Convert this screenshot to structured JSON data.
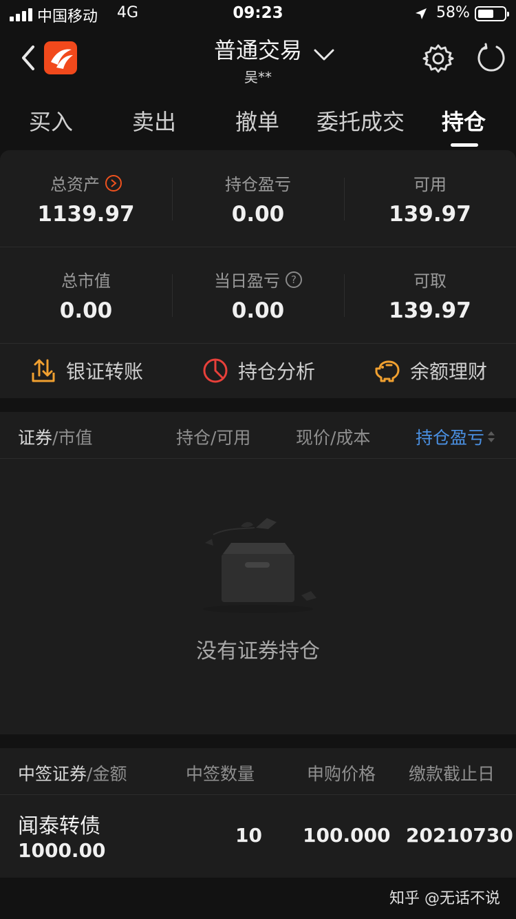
{
  "status_bar": {
    "carrier": "中国移动",
    "network": "4G",
    "time": "09:23",
    "battery": "58%",
    "battery_level": 0.58
  },
  "header": {
    "title": "普通交易",
    "account": "吴**"
  },
  "tabs": [
    "买入",
    "卖出",
    "撤单",
    "委托成交",
    "持仓"
  ],
  "active_tab": "持仓",
  "summary": {
    "total_assets_label": "总资产",
    "total_assets_value": "1139.97",
    "position_pl_label": "持仓盈亏",
    "position_pl_value": "0.00",
    "available_label": "可用",
    "available_value": "139.97",
    "market_value_label": "总市值",
    "market_value_value": "0.00",
    "daily_pl_label": "当日盈亏",
    "daily_pl_value": "0.00",
    "withdrawable_label": "可取",
    "withdrawable_value": "139.97",
    "help_glyph": "?"
  },
  "actions": {
    "bank_transfer": "银证转账",
    "position_analysis": "持仓分析",
    "balance_finance": "余额理财"
  },
  "positions_table": {
    "col1_main": "证券",
    "col1_sep": "/",
    "col1_sub": "市值",
    "col2": "持仓/可用",
    "col3": "现价/成本",
    "col4": "持仓盈亏",
    "empty_text": "没有证券持仓"
  },
  "lottery_table": {
    "col1_main": "中签证券",
    "col1_sep": "/",
    "col1_sub": "金额",
    "col2": "中签数量",
    "col3": "申购价格",
    "col4": "缴款截止日",
    "rows": [
      {
        "name": "闻泰转债",
        "amount": "1000.00",
        "quantity": "10",
        "price": "100.000",
        "deadline": "20210730"
      }
    ]
  },
  "watermark": "知乎 @无话不说",
  "colors": {
    "background": "#121212",
    "card": "#1d1d1d",
    "accent_orange": "#f0a030",
    "accent_red": "#e8403a",
    "sort_active_blue": "#4a90e2",
    "logo_orange": "#f1491c"
  }
}
